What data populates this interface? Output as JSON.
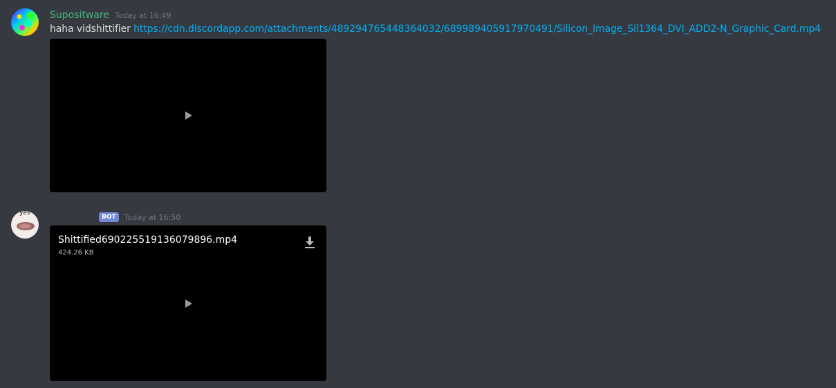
{
  "messages": [
    {
      "username": "Supositware",
      "timestamp": "Today at 16:49",
      "text": "haha vidshittifier ",
      "link": "https://cdn.discordapp.com/attachments/489294765448364032/689989405917970491/Silicon_Image_Sil1364_DVI_ADD2-N_Graphic_Card.mp4",
      "avatar_icon": "rainbow-globe-avatar"
    },
    {
      "username": "",
      "bot_tag": "BOT",
      "timestamp": "Today at 16:50",
      "avatar_icon": "cat-eyes-avatar",
      "avatar_text": "yes",
      "attachment": {
        "filename": "Shittified690225519136079896.mp4",
        "filesize": "424.26 KB"
      }
    }
  ],
  "colors": {
    "background": "#36393f",
    "username": "#43b581",
    "link": "#00b0f4",
    "bot_tag": "#7289da"
  }
}
